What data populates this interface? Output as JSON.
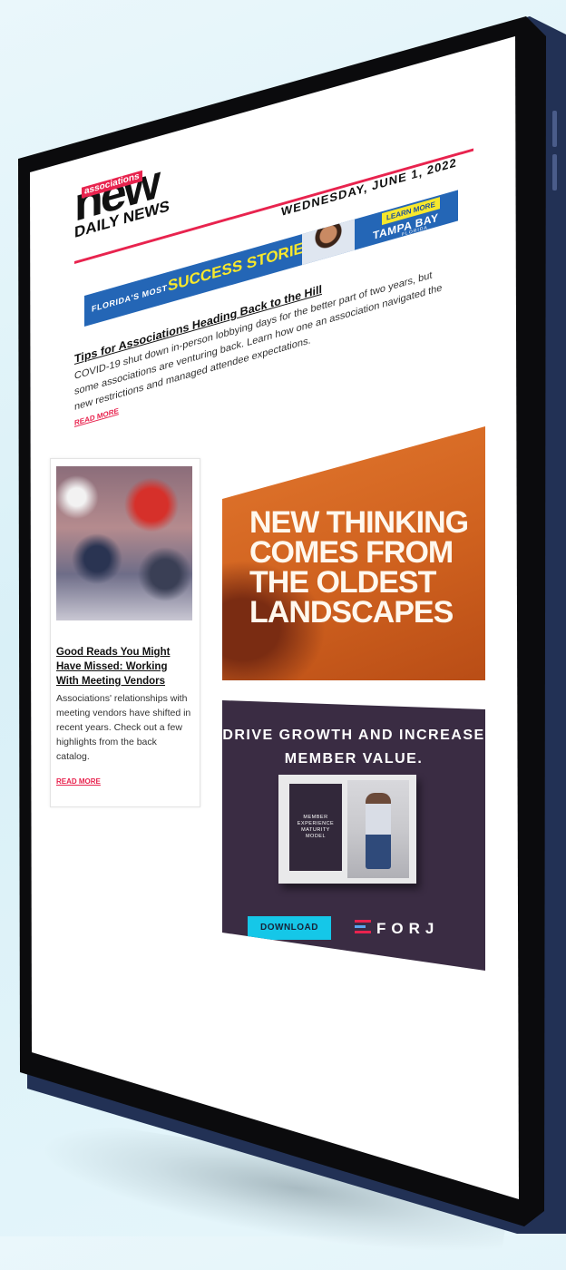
{
  "newsletter": {
    "logo": {
      "word": "new",
      "tag": "associations",
      "subtitle": "DAILY NEWS"
    },
    "date": "WEDNESDAY, JUNE 1, 2022"
  },
  "banner_ad": {
    "line1": "FLORIDA'S MOST",
    "line2": "SUCCESS STORIES",
    "cta": "LEARN MORE",
    "brand": "TAMPA BAY",
    "brand_sub": "FLORIDA"
  },
  "lead_article": {
    "title": "Tips for Associations Heading Back to the Hill",
    "body": "COVID-19 shut down in-person lobbying days for the better part of two years, but some associations are venturing back. Learn how one an association navigated the new restrictions and managed attendee expectations.",
    "read_more": "READ MORE"
  },
  "side_article": {
    "title": "Good Reads You Might Have Missed: Working With Meeting Vendors",
    "body": "Associations' relationships with meeting vendors have shifted in recent years. Check out a few highlights from the back catalog.",
    "read_more": "READ MORE"
  },
  "ad_landscapes": {
    "headline": "NEW THINKING COMES FROM THE OLDEST LANDSCAPES"
  },
  "ad_forj": {
    "headline": "DRIVE GROWTH AND INCREASE MEMBER VALUE.",
    "book_title": "MEMBER EXPERIENCE MATURITY MODEL",
    "button": "DOWNLOAD",
    "brand": "FORJ"
  },
  "colors": {
    "accent": "#e8234e",
    "banner_blue": "#2466b6",
    "banner_yellow": "#f7e82c",
    "ad_orange": "#d0621f",
    "ad_purple": "#3a2c43",
    "download_cyan": "#15c7e8",
    "tablet_frame": "#223155"
  }
}
